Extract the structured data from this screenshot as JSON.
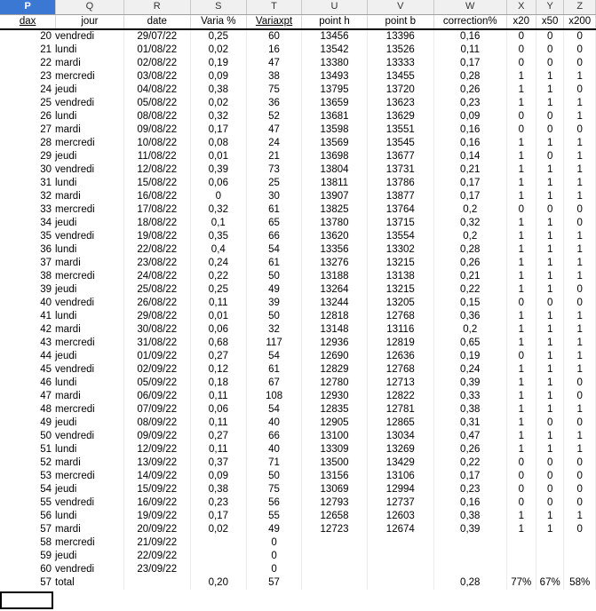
{
  "column_letters": [
    "P",
    "Q",
    "R",
    "S",
    "T",
    "U",
    "V",
    "W",
    "X",
    "Y",
    "Z"
  ],
  "headers": [
    "dax",
    "jour",
    "date",
    "Varia %",
    "Variaxpt",
    "point h",
    "point b",
    "correction%",
    "x20",
    "x50",
    "x200"
  ],
  "rows": [
    [
      "20",
      "vendredi",
      "29/07/22",
      "0,25",
      "60",
      "13456",
      "13396",
      "0,16",
      "0",
      "0",
      "0"
    ],
    [
      "21",
      "lundi",
      "01/08/22",
      "0,02",
      "16",
      "13542",
      "13526",
      "0,11",
      "0",
      "0",
      "0"
    ],
    [
      "22",
      "mardi",
      "02/08/22",
      "0,19",
      "47",
      "13380",
      "13333",
      "0,17",
      "0",
      "0",
      "0"
    ],
    [
      "23",
      "mercredi",
      "03/08/22",
      "0,09",
      "38",
      "13493",
      "13455",
      "0,28",
      "1",
      "1",
      "1"
    ],
    [
      "24",
      "jeudi",
      "04/08/22",
      "0,38",
      "75",
      "13795",
      "13720",
      "0,26",
      "1",
      "1",
      "0"
    ],
    [
      "25",
      "vendredi",
      "05/08/22",
      "0,02",
      "36",
      "13659",
      "13623",
      "0,23",
      "1",
      "1",
      "1"
    ],
    [
      "26",
      "lundi",
      "08/08/22",
      "0,32",
      "52",
      "13681",
      "13629",
      "0,09",
      "0",
      "0",
      "1"
    ],
    [
      "27",
      "mardi",
      "09/08/22",
      "0,17",
      "47",
      "13598",
      "13551",
      "0,16",
      "0",
      "0",
      "0"
    ],
    [
      "28",
      "mercredi",
      "10/08/22",
      "0,08",
      "24",
      "13569",
      "13545",
      "0,16",
      "1",
      "1",
      "1"
    ],
    [
      "29",
      "jeudi",
      "11/08/22",
      "0,01",
      "21",
      "13698",
      "13677",
      "0,14",
      "1",
      "0",
      "1"
    ],
    [
      "30",
      "vendredi",
      "12/08/22",
      "0,39",
      "73",
      "13804",
      "13731",
      "0,21",
      "1",
      "1",
      "1"
    ],
    [
      "31",
      "lundi",
      "15/08/22",
      "0,06",
      "25",
      "13811",
      "13786",
      "0,17",
      "1",
      "1",
      "1"
    ],
    [
      "32",
      "mardi",
      "16/08/22",
      "0",
      "30",
      "13907",
      "13877",
      "0,17",
      "1",
      "1",
      "1"
    ],
    [
      "33",
      "mercredi",
      "17/08/22",
      "0,32",
      "61",
      "13825",
      "13764",
      "0,2",
      "0",
      "0",
      "0"
    ],
    [
      "34",
      "jeudi",
      "18/08/22",
      "0,1",
      "65",
      "13780",
      "13715",
      "0,32",
      "1",
      "1",
      "0"
    ],
    [
      "35",
      "vendredi",
      "19/08/22",
      "0,35",
      "66",
      "13620",
      "13554",
      "0,2",
      "1",
      "1",
      "1"
    ],
    [
      "36",
      "lundi",
      "22/08/22",
      "0,4",
      "54",
      "13356",
      "13302",
      "0,28",
      "1",
      "1",
      "1"
    ],
    [
      "37",
      "mardi",
      "23/08/22",
      "0,24",
      "61",
      "13276",
      "13215",
      "0,26",
      "1",
      "1",
      "1"
    ],
    [
      "38",
      "mercredi",
      "24/08/22",
      "0,22",
      "50",
      "13188",
      "13138",
      "0,21",
      "1",
      "1",
      "1"
    ],
    [
      "39",
      "jeudi",
      "25/08/22",
      "0,25",
      "49",
      "13264",
      "13215",
      "0,22",
      "1",
      "1",
      "0"
    ],
    [
      "40",
      "vendredi",
      "26/08/22",
      "0,11",
      "39",
      "13244",
      "13205",
      "0,15",
      "0",
      "0",
      "0"
    ],
    [
      "41",
      "lundi",
      "29/08/22",
      "0,01",
      "50",
      "12818",
      "12768",
      "0,36",
      "1",
      "1",
      "1"
    ],
    [
      "42",
      "mardi",
      "30/08/22",
      "0,06",
      "32",
      "13148",
      "13116",
      "0,2",
      "1",
      "1",
      "1"
    ],
    [
      "43",
      "mercredi",
      "31/08/22",
      "0,68",
      "117",
      "12936",
      "12819",
      "0,65",
      "1",
      "1",
      "1"
    ],
    [
      "44",
      "jeudi",
      "01/09/22",
      "0,27",
      "54",
      "12690",
      "12636",
      "0,19",
      "0",
      "1",
      "1"
    ],
    [
      "45",
      "vendredi",
      "02/09/22",
      "0,12",
      "61",
      "12829",
      "12768",
      "0,24",
      "1",
      "1",
      "1"
    ],
    [
      "46",
      "lundi",
      "05/09/22",
      "0,18",
      "67",
      "12780",
      "12713",
      "0,39",
      "1",
      "1",
      "0"
    ],
    [
      "47",
      "mardi",
      "06/09/22",
      "0,11",
      "108",
      "12930",
      "12822",
      "0,33",
      "1",
      "1",
      "0"
    ],
    [
      "48",
      "mercredi",
      "07/09/22",
      "0,06",
      "54",
      "12835",
      "12781",
      "0,38",
      "1",
      "1",
      "1"
    ],
    [
      "49",
      "jeudi",
      "08/09/22",
      "0,11",
      "40",
      "12905",
      "12865",
      "0,31",
      "1",
      "0",
      "0"
    ],
    [
      "50",
      "vendredi",
      "09/09/22",
      "0,27",
      "66",
      "13100",
      "13034",
      "0,47",
      "1",
      "1",
      "1"
    ],
    [
      "51",
      "lundi",
      "12/09/22",
      "0,11",
      "40",
      "13309",
      "13269",
      "0,26",
      "1",
      "1",
      "1"
    ],
    [
      "52",
      "mardi",
      "13/09/22",
      "0,37",
      "71",
      "13500",
      "13429",
      "0,22",
      "0",
      "0",
      "0"
    ],
    [
      "53",
      "mercredi",
      "14/09/22",
      "0,09",
      "50",
      "13156",
      "13106",
      "0,17",
      "0",
      "0",
      "0"
    ],
    [
      "54",
      "jeudi",
      "15/09/22",
      "0,38",
      "75",
      "13069",
      "12994",
      "0,23",
      "0",
      "0",
      "0"
    ],
    [
      "55",
      "vendredi",
      "16/09/22",
      "0,23",
      "56",
      "12793",
      "12737",
      "0,16",
      "0",
      "0",
      "0"
    ],
    [
      "56",
      "lundi",
      "19/09/22",
      "0,17",
      "55",
      "12658",
      "12603",
      "0,38",
      "1",
      "1",
      "1"
    ],
    [
      "57",
      "mardi",
      "20/09/22",
      "0,02",
      "49",
      "12723",
      "12674",
      "0,39",
      "1",
      "1",
      "0"
    ],
    [
      "58",
      "mercredi",
      "21/09/22",
      "",
      "0",
      "",
      "",
      "",
      "",
      "",
      ""
    ],
    [
      "59",
      "jeudi",
      "22/09/22",
      "",
      "0",
      "",
      "",
      "",
      "",
      "",
      ""
    ],
    [
      "60",
      "vendredi",
      "23/09/22",
      "",
      "0",
      "",
      "",
      "",
      "",
      "",
      ""
    ]
  ],
  "total_row": [
    "57",
    "total",
    "",
    "0,20",
    "57",
    "",
    "",
    "0,28",
    "77%",
    "67%",
    "58%"
  ]
}
